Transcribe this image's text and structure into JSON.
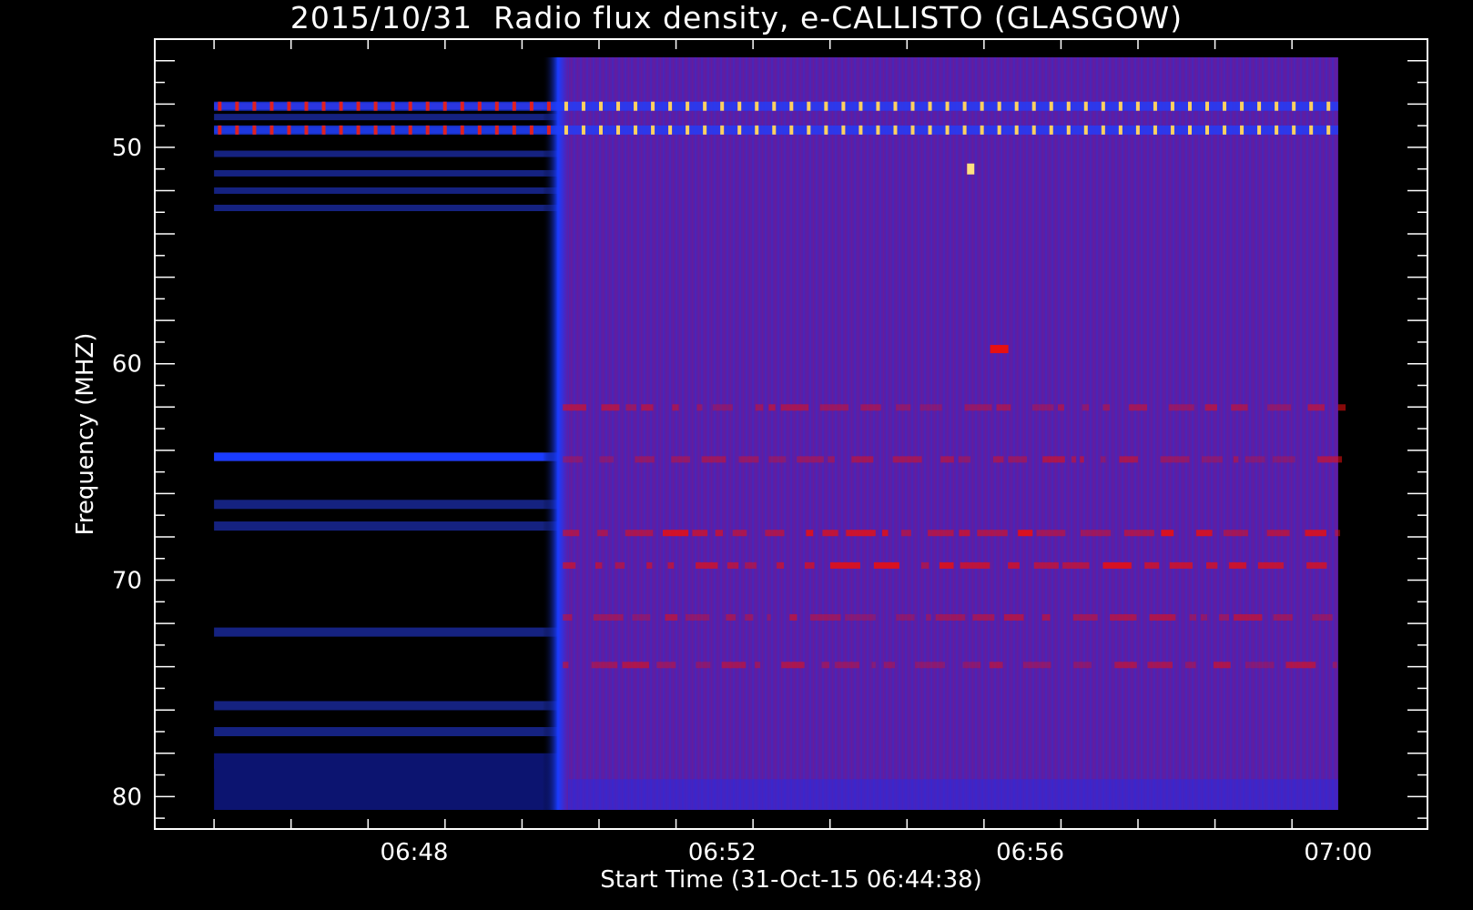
{
  "chart_data": {
    "type": "heatmap",
    "title": "2015/10/31  Radio flux density, e-CALLISTO (GLASGOW)",
    "xlabel": "Start Time (31-Oct-15 06:44:38)",
    "ylabel": "Frequency (MHZ)",
    "x_ticks": [
      "06:48",
      "06:52",
      "06:56",
      "07:00"
    ],
    "y_ticks": [
      "50",
      "60",
      "70",
      "80"
    ],
    "ylim": [
      45,
      81.5
    ],
    "y_inverted": true,
    "x_minutes_range": [
      0,
      16.53
    ],
    "x_tick_minutes": [
      3.37,
      7.37,
      11.37,
      15.37
    ],
    "data_start_minutes": 0.77,
    "data_end_minutes": 15.37,
    "instrument_on_minutes": 5.25,
    "colors": {
      "off_background": "#000000",
      "on_background": "#5a1ea8",
      "edge_glow": "#1a3cff",
      "rfi": "#e81010",
      "rfi_bright": "#ffd060"
    },
    "rfi_bands_mhz": [
      48.1,
      49.2,
      62.0,
      64.4,
      67.8,
      69.3,
      71.7,
      73.9
    ],
    "off_bands_mhz": [
      48.1,
      48.6,
      49.2,
      50.3,
      51.2,
      52.0,
      52.8,
      64.3,
      66.5,
      67.5,
      72.4,
      75.8,
      77.0,
      78.5
    ]
  }
}
